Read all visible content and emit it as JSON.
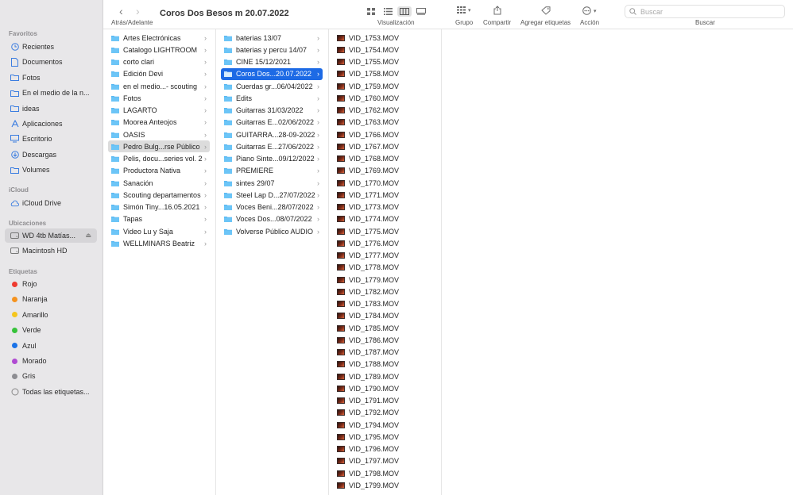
{
  "window": {
    "title": "Coros Dos Besos m 20.07.2022"
  },
  "toolbar": {
    "back_forward_label": "Atrás/Adelante",
    "view_label": "Visualización",
    "group_label": "Grupo",
    "share_label": "Compartir",
    "tags_label": "Agregar etiquetas",
    "action_label": "Acción",
    "search_label": "Buscar",
    "search_placeholder": "Buscar"
  },
  "sidebar": {
    "favorites_header": "Favoritos",
    "favorites": [
      {
        "label": "Recientes",
        "icon": "clock-icon"
      },
      {
        "label": "Documentos",
        "icon": "doc-icon"
      },
      {
        "label": "Fotos",
        "icon": "folder-icon"
      },
      {
        "label": "En el medio de la n...",
        "icon": "folder-icon"
      },
      {
        "label": "ideas",
        "icon": "folder-icon"
      },
      {
        "label": "Aplicaciones",
        "icon": "apps-icon"
      },
      {
        "label": "Escritorio",
        "icon": "desktop-icon"
      },
      {
        "label": "Descargas",
        "icon": "download-icon"
      },
      {
        "label": "Volumes",
        "icon": "folder-icon"
      }
    ],
    "icloud_header": "iCloud",
    "icloud": [
      {
        "label": "iCloud Drive",
        "icon": "cloud-icon"
      }
    ],
    "locations_header": "Ubicaciones",
    "locations": [
      {
        "label": "WD 4tb Matías...",
        "icon": "drive-icon"
      },
      {
        "label": "Macintosh HD",
        "icon": "drive-icon"
      }
    ],
    "tags_header": "Etiquetas",
    "tags": [
      {
        "label": "Rojo",
        "color": "#ee3b30"
      },
      {
        "label": "Naranja",
        "color": "#f5931f"
      },
      {
        "label": "Amarillo",
        "color": "#f5c61e"
      },
      {
        "label": "Verde",
        "color": "#37c23a"
      },
      {
        "label": "Azul",
        "color": "#1a73e8"
      },
      {
        "label": "Morado",
        "color": "#b04bd2"
      },
      {
        "label": "Gris",
        "color": "#8d8d92"
      },
      {
        "label": "Todas las etiquetas...",
        "color": ""
      }
    ]
  },
  "column1": [
    "Artes Electrónicas",
    "Catalogo LIGHTROOM",
    "corto clari",
    "Edición Devi",
    "en el medio...- scouting",
    "Fotos",
    "LAGARTO",
    "Moorea Anteojos",
    "OASIS",
    "Pedro Bulg...rse Público",
    "Pelis, docu...series vol. 2",
    "Productora Nativa",
    "Sanación",
    "Scouting departamentos",
    "Simón Tiny...16.05.2021",
    "Tapas",
    "Video Lu y Saja",
    "WELLMINARS Beatriz"
  ],
  "column2": [
    "baterias 13/07",
    "baterias y percu 14/07",
    "CINE 15/12/2021",
    "Coros Dos...20.07.2022",
    "Cuerdas gr...06/04/2022",
    "Edits",
    "Guitarras 31/03/2022",
    "Guitarras E...02/06/2022",
    "GUITARRA...28-09-2022",
    "Guitarras E...27/06/2022",
    "Piano Sinte...09/12/2022",
    "PREMIERE",
    "sintes 29/07",
    "Steel Lap D...27/07/2022",
    "Voces Beni...28/07/2022",
    "Voces Dos...08/07/2022",
    "Volverse Público AUDIO"
  ],
  "column3": [
    "VID_1753.MOV",
    "VID_1754.MOV",
    "VID_1755.MOV",
    "VID_1758.MOV",
    "VID_1759.MOV",
    "VID_1760.MOV",
    "VID_1762.MOV",
    "VID_1763.MOV",
    "VID_1766.MOV",
    "VID_1767.MOV",
    "VID_1768.MOV",
    "VID_1769.MOV",
    "VID_1770.MOV",
    "VID_1771.MOV",
    "VID_1773.MOV",
    "VID_1774.MOV",
    "VID_1775.MOV",
    "VID_1776.MOV",
    "VID_1777.MOV",
    "VID_1778.MOV",
    "VID_1779.MOV",
    "VID_1782.MOV",
    "VID_1783.MOV",
    "VID_1784.MOV",
    "VID_1785.MOV",
    "VID_1786.MOV",
    "VID_1787.MOV",
    "VID_1788.MOV",
    "VID_1789.MOV",
    "VID_1790.MOV",
    "VID_1791.MOV",
    "VID_1792.MOV",
    "VID_1794.MOV",
    "VID_1795.MOV",
    "VID_1796.MOV",
    "VID_1797.MOV",
    "VID_1798.MOV",
    "VID_1799.MOV"
  ],
  "selection": {
    "column1_index": 9,
    "column2_index": 3
  },
  "colors": {
    "accent": "#1d6ae5",
    "folder": "#5ab8f2"
  }
}
